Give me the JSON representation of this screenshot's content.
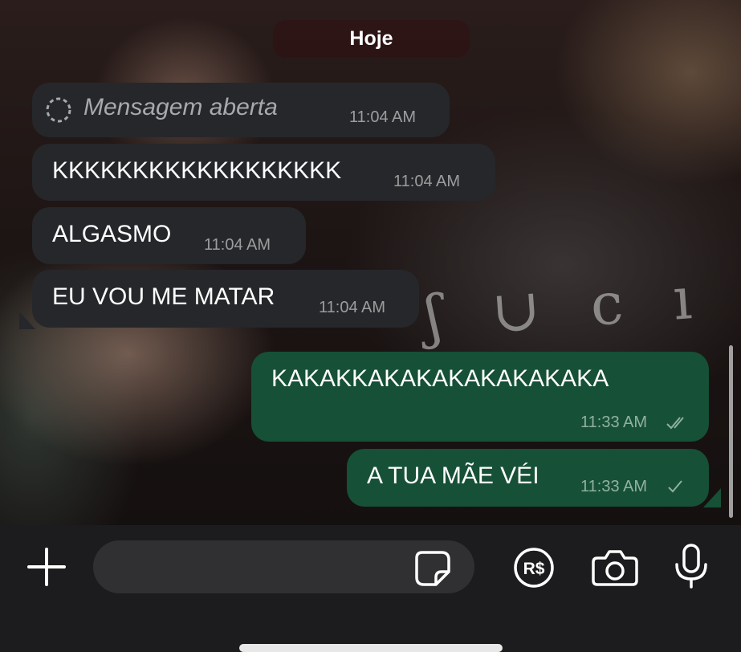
{
  "date_separator": "Hoje",
  "messages": [
    {
      "direction": "incoming",
      "text": "Mensagem aberta",
      "time": "11:04 AM",
      "kind": "view-once-opened",
      "icon": "view-once-opened-icon"
    },
    {
      "direction": "incoming",
      "text": "KKKKKKKKKKKKKKKKKK",
      "time": "11:04 AM"
    },
    {
      "direction": "incoming",
      "text": "ALGASMO",
      "time": "11:04 AM"
    },
    {
      "direction": "incoming",
      "text": "EU VOU ME MATAR",
      "time": "11:04 AM"
    },
    {
      "direction": "outgoing",
      "text": "KAKAKKAKAKAKAKAKAKAKA",
      "time": "11:33 AM",
      "status": "delivered",
      "status_icon": "double-check-icon"
    },
    {
      "direction": "outgoing",
      "text": "A TUA MÃE VÉI",
      "time": "11:33 AM",
      "status": "sent",
      "status_icon": "single-check-icon"
    }
  ],
  "composer": {
    "input_value": "",
    "icons": [
      "plus-icon",
      "sticker-icon",
      "payment-icon",
      "camera-icon",
      "microphone-icon"
    ],
    "payment_label": "R$"
  },
  "colors": {
    "incoming_bubble": "#26272a",
    "outgoing_bubble": "#165037",
    "toolbar": "#1c1c1e"
  }
}
